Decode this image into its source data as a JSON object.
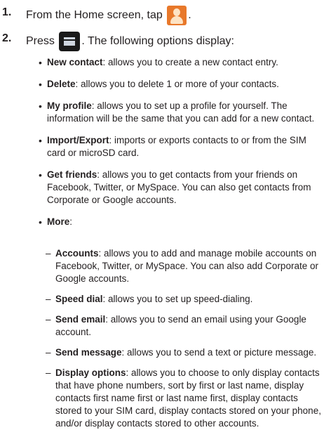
{
  "steps": [
    {
      "num": "1.",
      "before": "From the Home screen, tap",
      "after": "."
    },
    {
      "num": "2.",
      "before": "Press",
      "after": ". The following options display:"
    }
  ],
  "options": [
    {
      "term": "New contact",
      "desc": ": allows you to create a new contact entry."
    },
    {
      "term": "Delete",
      "desc": ": allows you to delete 1 or more of your contacts."
    },
    {
      "term": "My profile",
      "desc": ": allows you to set up a profile for yourself. The information will be the same that you can add for a new contact."
    },
    {
      "term": "Import/Export",
      "desc": ": imports or exports contacts to or from the SIM card or microSD card."
    },
    {
      "term": "Get friends",
      "desc": ": allows you to get contacts from your friends on Facebook, Twitter, or MySpace. You can also get contacts from Corporate or Google accounts."
    },
    {
      "term": "More",
      "desc": ":"
    }
  ],
  "more_options": [
    {
      "term": "Accounts",
      "desc": ": allows you to add and manage mobile accounts on Facebook, Twitter, or MySpace. You can also add Corporate or Google accounts."
    },
    {
      "term": "Speed dial",
      "desc": ": allows you to set up speed-dialing."
    },
    {
      "term": "Send email",
      "desc": ": allows you to send an email using your Google account."
    },
    {
      "term": "Send message",
      "desc": ": allows you to send a text or picture message."
    },
    {
      "term": "Display options",
      "desc": ": allows you to choose to only display contacts that have phone numbers, sort by first or last name, display contacts first name first or last name first, display contacts stored to your SIM card, display contacts stored on your phone, and/or display contacts stored to other accounts."
    }
  ],
  "icons": {
    "contacts": "contacts-app-icon",
    "menu": "menu-key-icon"
  }
}
